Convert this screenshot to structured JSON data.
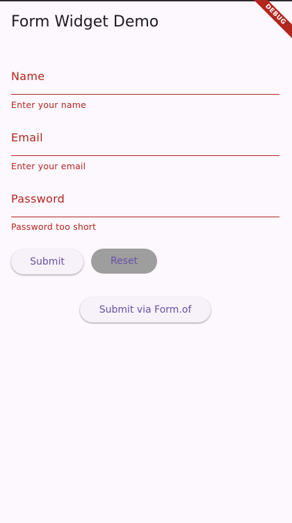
{
  "app_bar": {
    "title": "Form Widget Demo",
    "debug_banner": "DEBUG"
  },
  "form": {
    "fields": [
      {
        "label": "Name",
        "error": "Enter your name"
      },
      {
        "label": "Email",
        "error": "Enter your email"
      },
      {
        "label": "Password",
        "error": "Password too short"
      }
    ],
    "buttons": {
      "submit": "Submit",
      "reset": "Reset",
      "submit_form_of": "Submit via Form.of"
    }
  },
  "colors": {
    "background": "#fdf7fe",
    "error": "#b3261e",
    "primary": "#6750a4",
    "reset_button": "#9e9e9e"
  }
}
